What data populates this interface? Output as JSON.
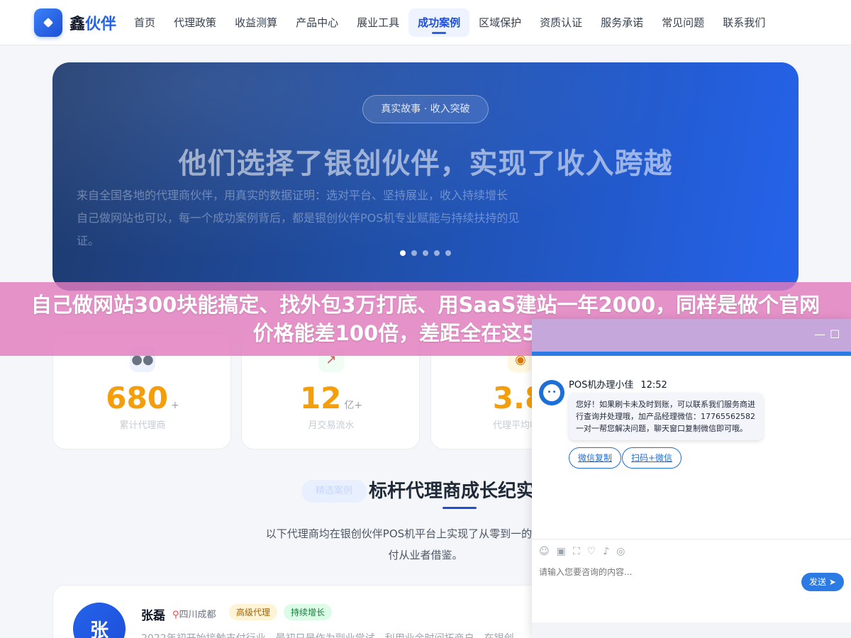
{
  "nav": {
    "brand_part1": "鑫",
    "brand_part2": "伙伴",
    "items": [
      "首页",
      "代理政策",
      "收益测算",
      "产品中心",
      "展业工具",
      "成功案例",
      "区域保护",
      "资质认证",
      "服务承诺",
      "常见问题",
      "联系我们"
    ],
    "active_index": 5
  },
  "hero": {
    "badge": "真实故事 · 收入突破",
    "title": "他们选择了银创伙伴，实现了收入跨越",
    "desc_line1": "来自全国各地的代理商伙伴，用真实的数据证明：选对平台、坚持展业，收入持续增长",
    "desc_line2": "自己做网站也可以，每一个成功案例背后，都是银创伙伴POS机专业赋能与持续扶持的见证。",
    "slide_count": 5,
    "active_slide": 0
  },
  "stats": [
    {
      "icon": "users-icon",
      "value": "680",
      "suffix": "+",
      "label": "累计代理商"
    },
    {
      "icon": "chart-icon",
      "value": "12",
      "suffix": "亿+",
      "label": "月交易流水"
    },
    {
      "icon": "medal-icon",
      "value": "3.8",
      "suffix": "",
      "label": "代理平均收益"
    }
  ],
  "section": {
    "tag": "精选案例",
    "title": "标杆代理商成长纪实",
    "desc_line1": "以下代理商均在银创伙伴POS机平台上实现了从零到一的跨越，他们",
    "desc_line2": "付从业者借鉴。"
  },
  "case": {
    "avatar_char": "张",
    "name": "张磊",
    "location": "四川成都",
    "tag1": "高级代理",
    "tag2": "持续增长",
    "text": "2022年初开始接触支付行业，最初只是作为副业尝试，利用业余时间拓商户，在银创"
  },
  "overlay": {
    "text": "自己做网站300块能搞定、找外包3万打底、用SaaS建站一年2000，同样是做个官网价格能差100倍，差距全在这5笔账上"
  },
  "chat": {
    "agent_name": "POS机办理小佳",
    "time": "12:52",
    "message": "您好！如果刷卡未及时到账，可以联系我们服务商进行查询并处理哦，加产品经理微信：17765562582 一对一帮您解决问题，聊天窗口复制微信即可哦。",
    "button1": "微信复制",
    "button2": "扫码+微信",
    "placeholder": "请输入您要咨询的内容...",
    "send": "发送",
    "minimize": "—",
    "maximize": "☐",
    "send_arrow": "➤",
    "tool_icons": [
      "☺",
      "▣",
      "⛶",
      "♡",
      "♪",
      "◎"
    ]
  },
  "colors": {
    "accent": "#2563eb",
    "stat_number": "#f59e0b",
    "overlay_pink": "#e27bbd"
  }
}
